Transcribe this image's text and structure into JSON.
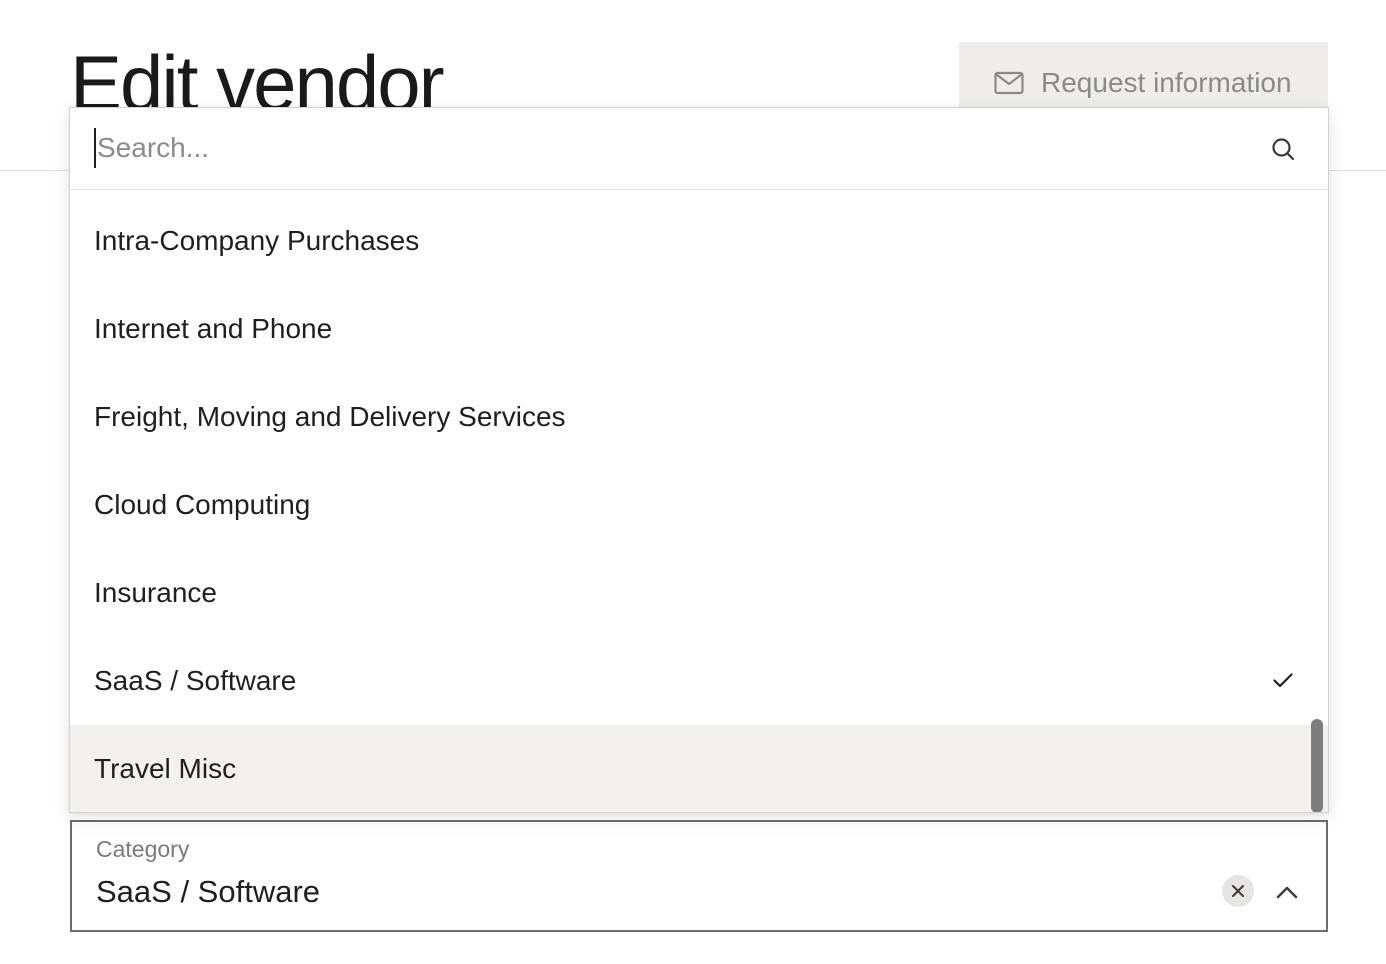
{
  "page": {
    "title": "Edit vendor"
  },
  "header": {
    "request_button_label": "Request information",
    "request_button_icon": "mail-icon"
  },
  "dropdown": {
    "search_placeholder": "Search...",
    "search_value": "",
    "search_icon": "search-icon",
    "options": [
      {
        "label": "Intra-Company Purchases",
        "selected": false,
        "highlighted": false
      },
      {
        "label": "Internet and Phone",
        "selected": false,
        "highlighted": false
      },
      {
        "label": "Freight, Moving and Delivery Services",
        "selected": false,
        "highlighted": false
      },
      {
        "label": "Cloud Computing",
        "selected": false,
        "highlighted": false
      },
      {
        "label": "Insurance",
        "selected": false,
        "highlighted": false
      },
      {
        "label": "SaaS / Software",
        "selected": true,
        "highlighted": false
      },
      {
        "label": "Travel Misc",
        "selected": false,
        "highlighted": true
      }
    ],
    "selected_icon": "check-icon"
  },
  "category_field": {
    "label": "Category",
    "value": "SaaS / Software",
    "clear_icon": "close-icon",
    "toggle_icon": "chevron-up-icon"
  },
  "colors": {
    "text": "#1f1f1f",
    "muted": "#8a8a8a",
    "highlight": "#f2f1ef",
    "button_bg": "#eeedeb",
    "scrollbar": "#7d7d7d"
  }
}
